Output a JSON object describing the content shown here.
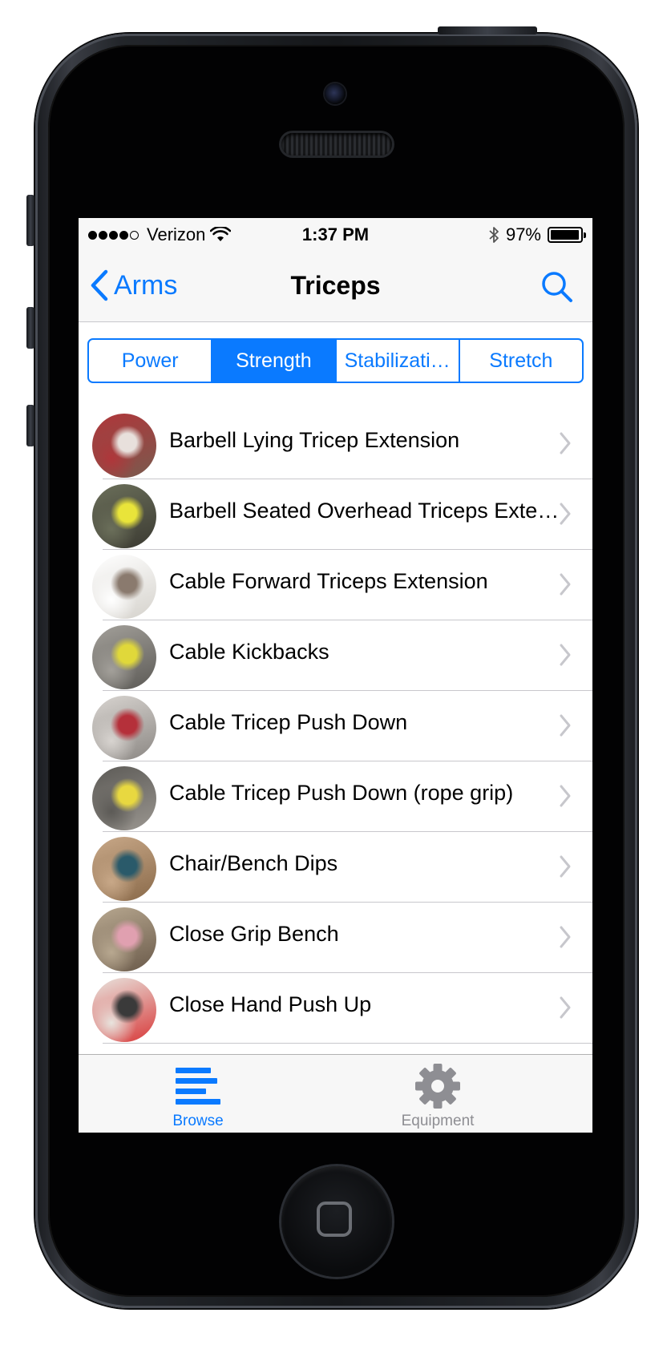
{
  "status_bar": {
    "carrier": "Verizon",
    "signal_bars_filled": 4,
    "signal_bars_total": 5,
    "time": "1:37 PM",
    "battery_percent_label": "97%",
    "battery_level": 0.97
  },
  "nav": {
    "back_label": "Arms",
    "title": "Triceps"
  },
  "segments": [
    {
      "label": "Power",
      "selected": false
    },
    {
      "label": "Strength",
      "selected": true
    },
    {
      "label": "Stabilizati…",
      "selected": false
    },
    {
      "label": "Stretch",
      "selected": false
    }
  ],
  "exercises": [
    {
      "label": "Barbell Lying Tricep Extension",
      "thumb_colors": [
        "#7a5a4e",
        "#e8e0dc",
        "#b0363a"
      ]
    },
    {
      "label": "Barbell Seated Overhead Triceps Exte…",
      "thumb_colors": [
        "#3b3a32",
        "#e9e43a",
        "#6b6f5a"
      ]
    },
    {
      "label": "Cable Forward Triceps Extension",
      "thumb_colors": [
        "#d5d2cc",
        "#8a7a6e",
        "#ffffff"
      ]
    },
    {
      "label": "Cable Kickbacks",
      "thumb_colors": [
        "#5c5a56",
        "#e0d83a",
        "#a3a09a"
      ]
    },
    {
      "label": "Cable Tricep Push Down",
      "thumb_colors": [
        "#8c8884",
        "#b5303a",
        "#d8d4d0"
      ]
    },
    {
      "label": "Cable Tricep Push Down (rope grip)",
      "thumb_colors": [
        "#9a9690",
        "#e8d840",
        "#5c5a56"
      ]
    },
    {
      "label": "Chair/Bench Dips",
      "thumb_colors": [
        "#8a6a4a",
        "#2a5a6a",
        "#c8a888"
      ]
    },
    {
      "label": "Close Grip Bench",
      "thumb_colors": [
        "#6a5a4a",
        "#e0a0b0",
        "#b8a890"
      ]
    },
    {
      "label": "Close Hand Push Up",
      "thumb_colors": [
        "#d83a3a",
        "#3a3a3a",
        "#e8e4de"
      ]
    }
  ],
  "tabs": [
    {
      "label": "Browse",
      "icon": "browse-icon",
      "active": true
    },
    {
      "label": "Equipment",
      "icon": "gear-icon",
      "active": false
    }
  ],
  "colors": {
    "accent": "#0a7aff",
    "inactive_tab": "#8e8e93",
    "bar_background": "#f7f7f7",
    "separator": "#c8c7cc"
  }
}
